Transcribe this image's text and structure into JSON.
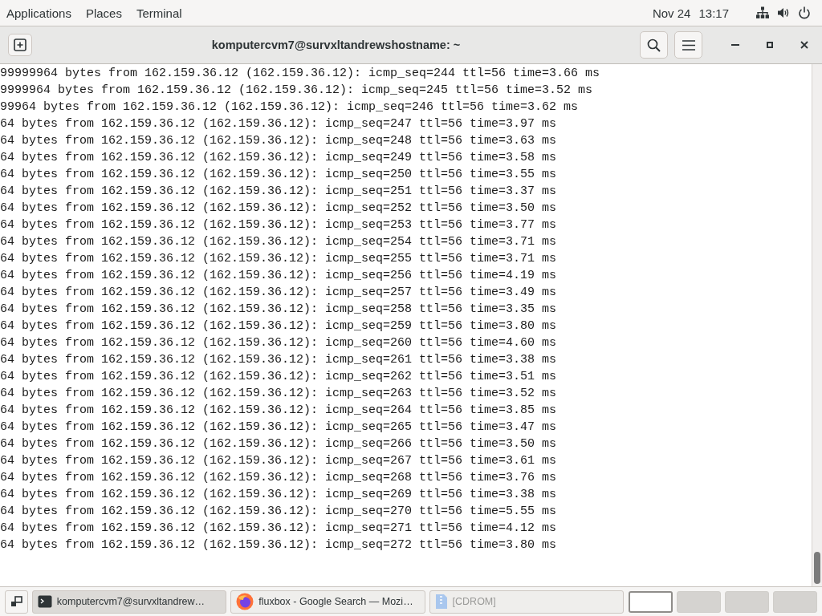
{
  "top_bar": {
    "menus": [
      "Applications",
      "Places",
      "Terminal"
    ],
    "date": "Nov 24",
    "time": "13:17"
  },
  "window": {
    "title": "komputercvm7@survxltandrewshostname: ~"
  },
  "terminal": {
    "lines": [
      "99999964 bytes from 162.159.36.12 (162.159.36.12): icmp_seq=244 ttl=56 time=3.66 ms",
      "9999964 bytes from 162.159.36.12 (162.159.36.12): icmp_seq=245 ttl=56 time=3.52 ms",
      "99964 bytes from 162.159.36.12 (162.159.36.12): icmp_seq=246 ttl=56 time=3.62 ms",
      "64 bytes from 162.159.36.12 (162.159.36.12): icmp_seq=247 ttl=56 time=3.97 ms",
      "64 bytes from 162.159.36.12 (162.159.36.12): icmp_seq=248 ttl=56 time=3.63 ms",
      "64 bytes from 162.159.36.12 (162.159.36.12): icmp_seq=249 ttl=56 time=3.58 ms",
      "64 bytes from 162.159.36.12 (162.159.36.12): icmp_seq=250 ttl=56 time=3.55 ms",
      "64 bytes from 162.159.36.12 (162.159.36.12): icmp_seq=251 ttl=56 time=3.37 ms",
      "64 bytes from 162.159.36.12 (162.159.36.12): icmp_seq=252 ttl=56 time=3.50 ms",
      "64 bytes from 162.159.36.12 (162.159.36.12): icmp_seq=253 ttl=56 time=3.77 ms",
      "64 bytes from 162.159.36.12 (162.159.36.12): icmp_seq=254 ttl=56 time=3.71 ms",
      "64 bytes from 162.159.36.12 (162.159.36.12): icmp_seq=255 ttl=56 time=3.71 ms",
      "64 bytes from 162.159.36.12 (162.159.36.12): icmp_seq=256 ttl=56 time=4.19 ms",
      "64 bytes from 162.159.36.12 (162.159.36.12): icmp_seq=257 ttl=56 time=3.49 ms",
      "64 bytes from 162.159.36.12 (162.159.36.12): icmp_seq=258 ttl=56 time=3.35 ms",
      "64 bytes from 162.159.36.12 (162.159.36.12): icmp_seq=259 ttl=56 time=3.80 ms",
      "64 bytes from 162.159.36.12 (162.159.36.12): icmp_seq=260 ttl=56 time=4.60 ms",
      "64 bytes from 162.159.36.12 (162.159.36.12): icmp_seq=261 ttl=56 time=3.38 ms",
      "64 bytes from 162.159.36.12 (162.159.36.12): icmp_seq=262 ttl=56 time=3.51 ms",
      "64 bytes from 162.159.36.12 (162.159.36.12): icmp_seq=263 ttl=56 time=3.52 ms",
      "64 bytes from 162.159.36.12 (162.159.36.12): icmp_seq=264 ttl=56 time=3.85 ms",
      "64 bytes from 162.159.36.12 (162.159.36.12): icmp_seq=265 ttl=56 time=3.47 ms",
      "64 bytes from 162.159.36.12 (162.159.36.12): icmp_seq=266 ttl=56 time=3.50 ms",
      "64 bytes from 162.159.36.12 (162.159.36.12): icmp_seq=267 ttl=56 time=3.61 ms",
      "64 bytes from 162.159.36.12 (162.159.36.12): icmp_seq=268 ttl=56 time=3.76 ms",
      "64 bytes from 162.159.36.12 (162.159.36.12): icmp_seq=269 ttl=56 time=3.38 ms",
      "64 bytes from 162.159.36.12 (162.159.36.12): icmp_seq=270 ttl=56 time=5.55 ms",
      "64 bytes from 162.159.36.12 (162.159.36.12): icmp_seq=271 ttl=56 time=4.12 ms",
      "64 bytes from 162.159.36.12 (162.159.36.12): icmp_seq=272 ttl=56 time=3.80 ms"
    ]
  },
  "taskbar": {
    "tasks": [
      {
        "kind": "terminal",
        "label": "komputercvm7@survxltandrew…",
        "selected": true,
        "minimized": false
      },
      {
        "kind": "browser",
        "label": "fluxbox - Google Search — Mozi…",
        "selected": false,
        "minimized": false
      },
      {
        "kind": "file",
        "label": "[CDROM]",
        "selected": false,
        "minimized": true
      }
    ],
    "workspaces": [
      {
        "selected": true
      },
      {
        "selected": false
      },
      {
        "selected": false
      },
      {
        "selected": false
      }
    ]
  }
}
